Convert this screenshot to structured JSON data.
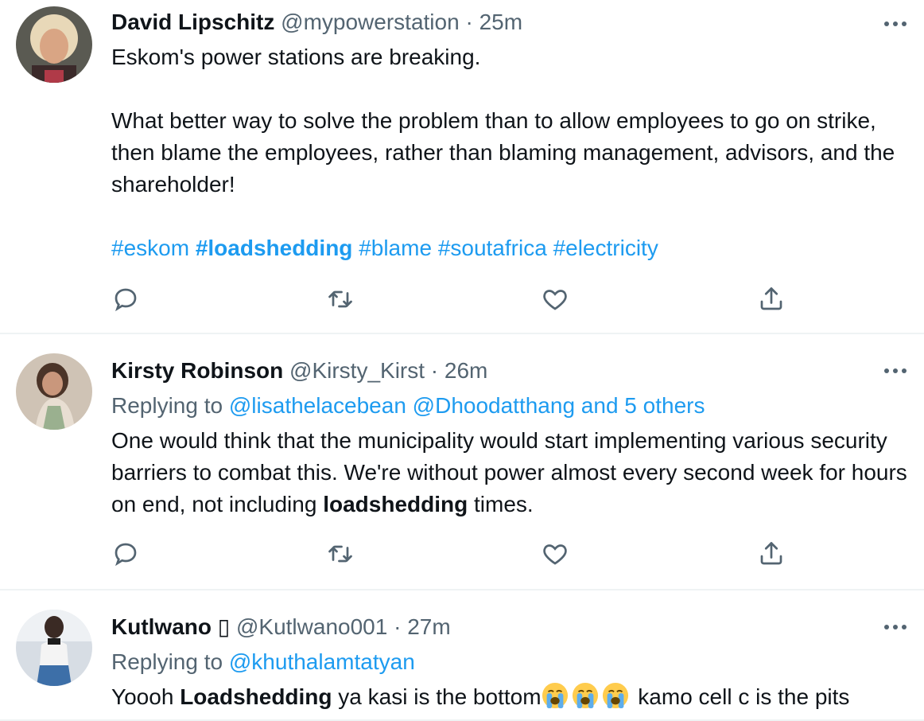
{
  "tweets": [
    {
      "name": "David Lipschitz",
      "handle": "@mypowerstation",
      "sep": "·",
      "time": "25m",
      "line1": "Eskom's power stations are breaking.",
      "line2": "What better way to solve the problem than to allow employees to go on strike, then blame the employees, rather than blaming management, advisors, and the shareholder!",
      "hashtags": [
        {
          "text": "#eskom",
          "bold": false
        },
        {
          "text": "#loadshedding",
          "bold": true
        },
        {
          "text": "#blame",
          "bold": false
        },
        {
          "text": "#soutafrica",
          "bold": false
        },
        {
          "text": "#electricity",
          "bold": false
        }
      ]
    },
    {
      "name": "Kirsty Robinson",
      "handle": "@Kirsty_Kirst",
      "sep": "·",
      "time": "26m",
      "replying_prefix": "Replying to",
      "replying_to": "@lisathelacebean @Dhoodatthang and 5 others",
      "text_before": "One would think that the municipality would start implementing various security barriers to combat this. We're without power almost every second week for hours on end, not including ",
      "text_bold": "loadshedding",
      "text_after": " times."
    },
    {
      "name": "Kutlwano",
      "name_glyph": "▯",
      "handle": "@Kutlwano001",
      "sep": "·",
      "time": "27m",
      "replying_prefix": "Replying to",
      "replying_to": "@khuthalamtatyan",
      "text_before": "Yoooh ",
      "text_bold": "Loadshedding",
      "text_after_1": " ya kasi is the bottom",
      "text_after_2": " kamo cell c is the pits",
      "emojis": [
        "loudly-crying-face-emoji",
        "loudly-crying-face-emoji",
        "loudly-crying-face-emoji"
      ]
    }
  ],
  "actions": [
    "reply-icon",
    "retweet-icon",
    "like-icon",
    "share-icon"
  ],
  "colors": {
    "link": "#1d9bf0",
    "muted": "#536471",
    "text": "#0f1419",
    "divider": "#eff3f4"
  }
}
